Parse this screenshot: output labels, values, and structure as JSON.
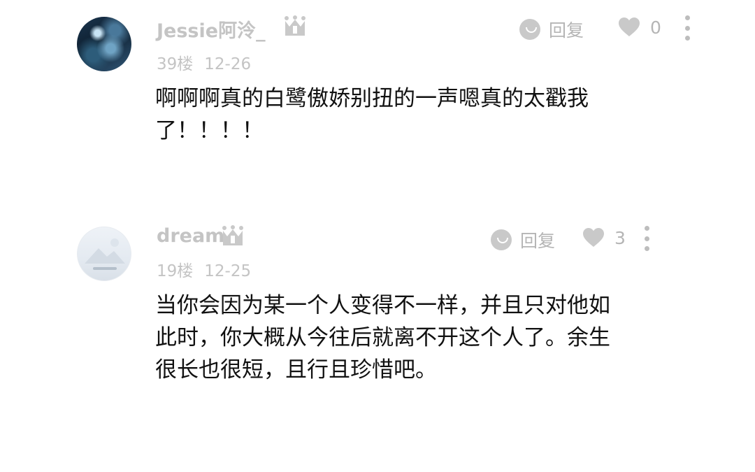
{
  "comments": [
    {
      "username": "Jessie阿泠_",
      "badge_icon": "crown-level-icon",
      "floor": "39楼",
      "date": "12-26",
      "reply_label": "回复",
      "like_count": "0",
      "text": "啊啊啊真的白鹭傲娇别扭的一声嗯真的太戳我\n了！！！！"
    },
    {
      "username": "dream",
      "badge_icon": "crown-level-icon",
      "floor": "19楼",
      "date": "12-25",
      "reply_label": "回复",
      "like_count": "3",
      "text": "当你会因为某一个人变得不一样，并且只对他如\n此时，你大概从今往后就离不开这个人了。余生\n很长也很短，且行且珍惜吧。"
    }
  ],
  "colors": {
    "muted": "#c4c4c4",
    "icon": "#c9c9c9",
    "text": "#111111",
    "background": "#ffffff"
  }
}
